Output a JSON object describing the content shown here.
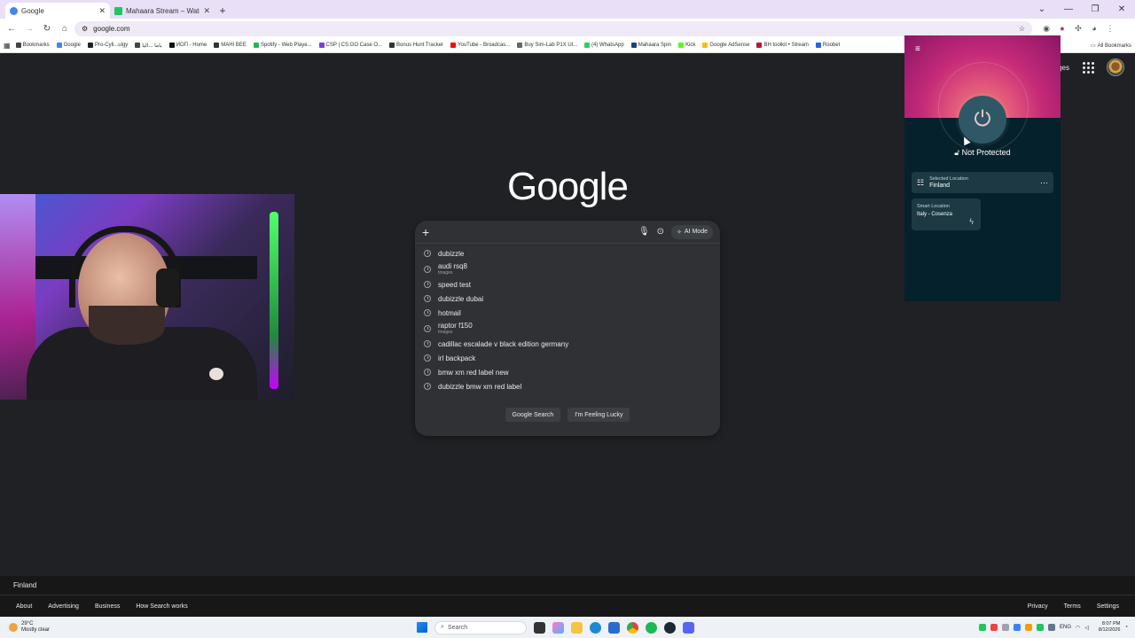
{
  "browser": {
    "tabs": [
      {
        "title": "Google",
        "color": "#4285f4",
        "active": true
      },
      {
        "title": "Mahaara Stream – Watch Live ...",
        "color": "#22c55e",
        "active": false
      }
    ],
    "new_tab_symbol": "+",
    "window_controls": [
      "⌄",
      "—",
      "❐",
      "✕"
    ],
    "url": "google.com",
    "bookmarks": [
      {
        "label": "Bookmarks",
        "color": "#444"
      },
      {
        "label": "Google",
        "color": "#4285f4"
      },
      {
        "label": "Pro-Cyli...ulgy",
        "color": "#222"
      },
      {
        "label": "ياما ...اليا",
        "color": "#444"
      },
      {
        "label": "ИОП - Home",
        "color": "#111"
      },
      {
        "label": "MAHI BEE",
        "color": "#333"
      },
      {
        "label": "Spotify - Web Playe...",
        "color": "#1db954"
      },
      {
        "label": "CSP | CS:GO Case O...",
        "color": "#7c3aed"
      },
      {
        "label": "Bonus Hunt Tracker",
        "color": "#333"
      },
      {
        "label": "YouTube - Broadcas...",
        "color": "#ff0000"
      },
      {
        "label": "Buy Sim-Lab P1X Ul...",
        "color": "#666"
      },
      {
        "label": "(4) WhatsApp",
        "color": "#25d366"
      },
      {
        "label": "Mahaara Spin",
        "color": "#1e3a8a"
      },
      {
        "label": "Kick",
        "color": "#53fc18"
      },
      {
        "label": "Google AdSense",
        "color": "#fbbc04"
      },
      {
        "label": "BH toolkit • Stream",
        "color": "#be123c"
      },
      {
        "label": "Roobet",
        "color": "#2563eb"
      }
    ],
    "all_bookmarks": "All Bookmarks"
  },
  "google": {
    "logo": "Google",
    "top_links": {
      "images": "Images"
    },
    "search": {
      "placeholder": "",
      "ai_mode": "AI Mode"
    },
    "suggestions": [
      {
        "text": "dubizzle",
        "sub": ""
      },
      {
        "text": "audi rsq8",
        "sub": "Images"
      },
      {
        "text": "speed test",
        "sub": ""
      },
      {
        "text": "dubizzle dubai",
        "sub": ""
      },
      {
        "text": "hotmail",
        "sub": ""
      },
      {
        "text": "raptor f150",
        "sub": "Images"
      },
      {
        "text": "cadillac escalade v black edition germany",
        "sub": ""
      },
      {
        "text": "irl backpack",
        "sub": ""
      },
      {
        "text": "bmw xm red label new",
        "sub": ""
      },
      {
        "text": "dubizzle bmw xm red label",
        "sub": ""
      }
    ],
    "buttons": {
      "search": "Google Search",
      "lucky": "I'm Feeling Lucky"
    },
    "footer": {
      "country": "Finland",
      "left_links": [
        "About",
        "Advertising",
        "Business",
        "How Search works"
      ],
      "right_links": [
        "Privacy",
        "Terms",
        "Settings"
      ]
    }
  },
  "vpn": {
    "status": "Not Protected",
    "selected_location_label": "Selected Location",
    "selected_location": "Finland",
    "smart_location_label": "Smart Location",
    "smart_location": "Italy - Cosenza",
    "accent": "#c52a78"
  },
  "taskbar": {
    "weather_temp": "29°C",
    "weather_desc": "Mostly clear",
    "search_placeholder": "Search",
    "language": "ENG",
    "time": "8:07 PM",
    "date": "8/12/2026"
  }
}
